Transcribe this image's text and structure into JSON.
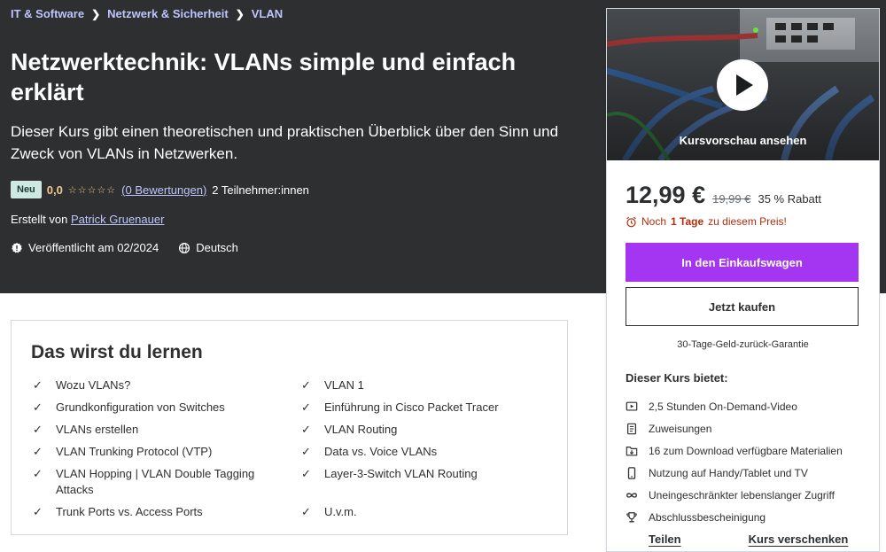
{
  "breadcrumb": [
    "IT & Software",
    "Netzwerk & Sicherheit",
    "VLAN"
  ],
  "course": {
    "title": "Netzwerktechnik: VLANs simple und einfach erklärt",
    "subtitle": "Dieser Kurs gibt einen theoretischen und praktischen Überblick über den Sinn und Zweck von VLANs in Netzwerken.",
    "badge": "Neu",
    "rating": "0,0",
    "stars": "☆☆☆☆☆",
    "ratings_link": "(0 Bewertungen)",
    "participants": "2 Teilnehmer:innen",
    "created_by_label": "Erstellt von",
    "instructor": "Patrick Gruenauer",
    "published": "Veröffentlicht am 02/2024",
    "language": "Deutsch"
  },
  "learn": {
    "title": "Das wirst du lernen",
    "left": [
      "Wozu VLANs?",
      "Grundkonfiguration von Switches",
      "VLANs erstellen",
      "VLAN Trunking Protocol (VTP)",
      "VLAN Hopping | VLAN Double Tagging Attacks",
      "Trunk Ports vs. Access Ports"
    ],
    "right": [
      "VLAN 1",
      "Einführung in Cisco Packet Tracer",
      "VLAN Routing",
      "Data vs. Voice VLANs",
      "Layer-3-Switch VLAN Routing",
      "U.v.m."
    ]
  },
  "sidebar": {
    "preview_label": "Kursvorschau ansehen",
    "price": "12,99 €",
    "old_price": "19,99 €",
    "discount": "35 % Rabatt",
    "deadline_prefix": "Noch",
    "deadline_days": "1 Tage",
    "deadline_suffix": "zu diesem Preis!",
    "cart_button": "In den Einkaufswagen",
    "buy_button": "Jetzt kaufen",
    "guarantee": "30-Tage-Geld-zurück-Garantie",
    "includes_title": "Dieser Kurs bietet:",
    "includes": [
      {
        "icon": "video-icon",
        "label": "2,5 Stunden On-Demand-Video"
      },
      {
        "icon": "assignment-icon",
        "label": "Zuweisungen"
      },
      {
        "icon": "download-icon",
        "label": "16 zum Download verfügbare Materialien"
      },
      {
        "icon": "mobile-icon",
        "label": "Nutzung auf Handy/Tablet und TV"
      },
      {
        "icon": "infinity-icon",
        "label": "Uneingeschränkter lebenslanger Zugriff"
      },
      {
        "icon": "trophy-icon",
        "label": "Abschlussbescheinigung"
      }
    ],
    "share_link": "Teilen",
    "gift_link": "Kurs verschenken"
  },
  "colors": {
    "hero_bg": "#2d2f31",
    "accent_purple": "#a435f0",
    "link_lavender": "#c0c4fc",
    "star_gold": "#f3ca8c",
    "deadline_red": "#b32d0f"
  }
}
